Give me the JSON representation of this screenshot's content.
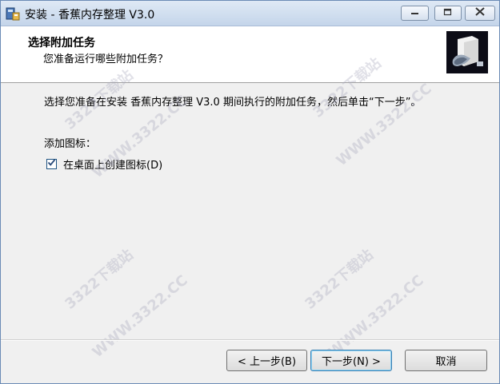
{
  "window": {
    "title": "安装 - 香蕉内存整理 V3.0"
  },
  "header": {
    "title": "选择附加任务",
    "subtitle": "您准备运行哪些附加任务？"
  },
  "content": {
    "description": "选择您准备在安装 香蕉内存整理 V3.0 期间执行的附加任务，然后单击“下一步”。",
    "group_label": "添加图标：",
    "checkbox_label": "在桌面上创建图标(D)",
    "checkbox_checked": true
  },
  "watermarks": {
    "brand": "3322下载站",
    "url": "WWW.3322.CC"
  },
  "buttons": {
    "back": "< 上一步(B)",
    "next": "下一步(N) >",
    "cancel": "取消"
  },
  "icons": {
    "minimize": "minimize-icon",
    "maximize": "maximize-icon",
    "close": "close-icon",
    "app": "installer-app-icon",
    "header_logo": "setup-box-icon",
    "check": "check-icon"
  }
}
